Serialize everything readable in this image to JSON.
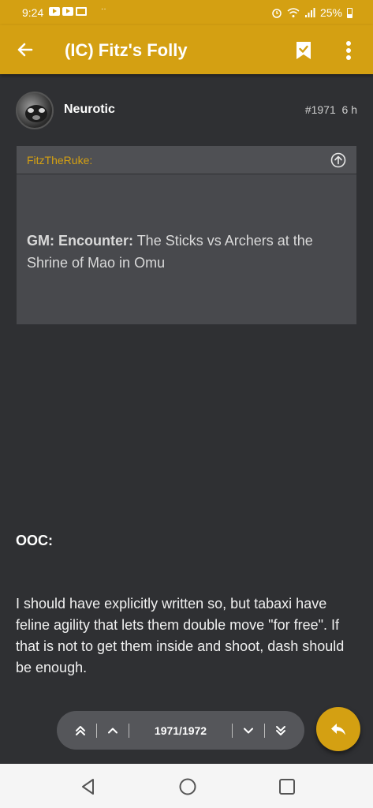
{
  "status_bar": {
    "time": "9:24",
    "battery": "25%",
    "overflow": "··"
  },
  "app_bar": {
    "title": "(IC) Fitz's Folly",
    "icons": [
      "back-arrow-icon",
      "bookmark-icon",
      "more-vert-icon"
    ]
  },
  "post": {
    "author": "Neurotic",
    "number": "#1971",
    "age": "6 h",
    "quote": {
      "author": "FitzTheRuke:",
      "label": "GM: Encounter:",
      "text": "The Sticks vs Archers at the Shrine of Mao in Omu"
    },
    "ooc_label": "OOC:",
    "body": "I should have explicitly written so, but tabaxi have feline agility that lets them double move \"for free\". If that is not to get them inside and shoot, dash should be enough."
  },
  "pager": {
    "current": "1971/1972"
  },
  "colors": {
    "accent": "#d4a012",
    "background": "#2f3033",
    "quote_bg": "#48494d",
    "nav_bg": "#f5f5f5"
  }
}
